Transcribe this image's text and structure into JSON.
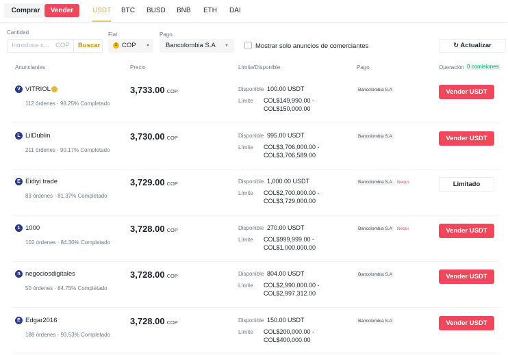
{
  "mode": {
    "buy": "Comprar",
    "sell": "Vender"
  },
  "tabs": [
    "USDT",
    "BTC",
    "BUSD",
    "BNB",
    "ETH",
    "DAI"
  ],
  "filters": {
    "amount_label": "Cantidad",
    "amount_placeholder": "Introduce c...",
    "amount_currency": "COP",
    "search": "Buscar",
    "fiat_label": "Fiat",
    "fiat_value": "COP",
    "pay_label": "Pago",
    "pay_value": "Bancolombia S.A",
    "merchant_only": "Mostrar solo anuncios de comerciantes",
    "refresh": "Actualizar"
  },
  "columns": {
    "advertisers": "Anunciantes",
    "price": "Precio",
    "limit": "Límite/Disponible",
    "payment": "Pago",
    "operation": "Operación",
    "fee_badge": "0 comisiones"
  },
  "labels": {
    "available": "Disponible",
    "limit": "Límite",
    "currency": "COP"
  },
  "accent": "#f0475c",
  "rows": [
    {
      "initial": "V",
      "name": "VITRIOL",
      "verified": true,
      "stats": "112 órdenes · 98.25% Completado",
      "price": "3,733.00",
      "available": "100.00 USDT",
      "limit_min": "COL$149,990.00 -",
      "limit_max": "COL$150,000.00",
      "payments": [
        "Bancolombia S.A"
      ],
      "action": "Vender USDT"
    },
    {
      "initial": "L",
      "name": "LilDublin",
      "stats": "211 órdenes · 90.17% Completado",
      "price": "3,730.00",
      "available": "995.00 USDT",
      "limit_min": "COL$3,706,000.00 -",
      "limit_max": "COL$3,706,589.00",
      "payments": [
        "Bancolombia S.A"
      ],
      "action": "Vender USDT"
    },
    {
      "initial": "E",
      "name": "Eidiyi trade",
      "stats": "83 órdenes · 81.37% Completado",
      "price": "3,729.00",
      "available": "1,000.00 USDT",
      "limit_min": "COL$2,700,000.00 -",
      "limit_max": "COL$3,729,000.00",
      "payments": [
        "Bancolombia S.A",
        "Nequi"
      ],
      "action": "Limitado"
    },
    {
      "initial": "1",
      "name": "1000",
      "stats": "102 órdenes · 84.30% Completado",
      "price": "3,728.00",
      "available": "270.00 USDT",
      "limit_min": "COL$999,999.00 -",
      "limit_max": "COL$1,000,000.00",
      "payments": [
        "Bancolombia S.A",
        "Nequi"
      ],
      "action": "Vender USDT"
    },
    {
      "initial": "n",
      "name": "negociosdigitales",
      "stats": "50 órdenes · 84.75% Completado",
      "price": "3,728.00",
      "available": "804.00 USDT",
      "limit_min": "COL$2,990,000.00 -",
      "limit_max": "COL$2,997,312.00",
      "payments": [
        "Bancolombia S.A"
      ],
      "action": "Vender USDT"
    },
    {
      "initial": "E",
      "name": "Edgar2016",
      "stats": "188 órdenes · 93.53% Completado",
      "price": "3,728.00",
      "available": "150.00 USDT",
      "limit_min": "COL$200,000.00 -",
      "limit_max": "COL$400,000.00",
      "payments": [
        "Bancolombia S.A"
      ],
      "action": "Vender USDT"
    }
  ]
}
